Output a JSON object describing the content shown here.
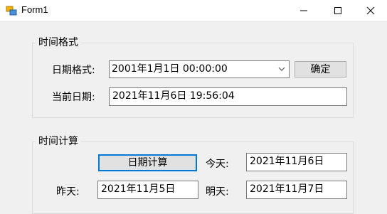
{
  "window": {
    "title": "Form1",
    "icons": {
      "app": "form-app-icon",
      "minimize": "minimize-icon",
      "maximize": "maximize-icon",
      "close": "close-icon"
    }
  },
  "format_group": {
    "legend": "时间格式",
    "format_label": "日期格式:",
    "format_value": "2001年1月1日  00:00:00",
    "confirm_button": "确定",
    "current_label": "当前日期:",
    "current_value": "2021年11月6日  19:56:04"
  },
  "calc_group": {
    "legend": "时间计算",
    "calc_button": "日期计算",
    "today_label": "今天:",
    "today_value": "2021年11月6日",
    "yesterday_label": "昨天:",
    "yesterday_value": "2021年11月5日",
    "tomorrow_label": "明天:",
    "tomorrow_value": "2021年11月7日"
  },
  "colors": {
    "accent": "#0078d7",
    "window_bg": "#f0f0f0"
  }
}
